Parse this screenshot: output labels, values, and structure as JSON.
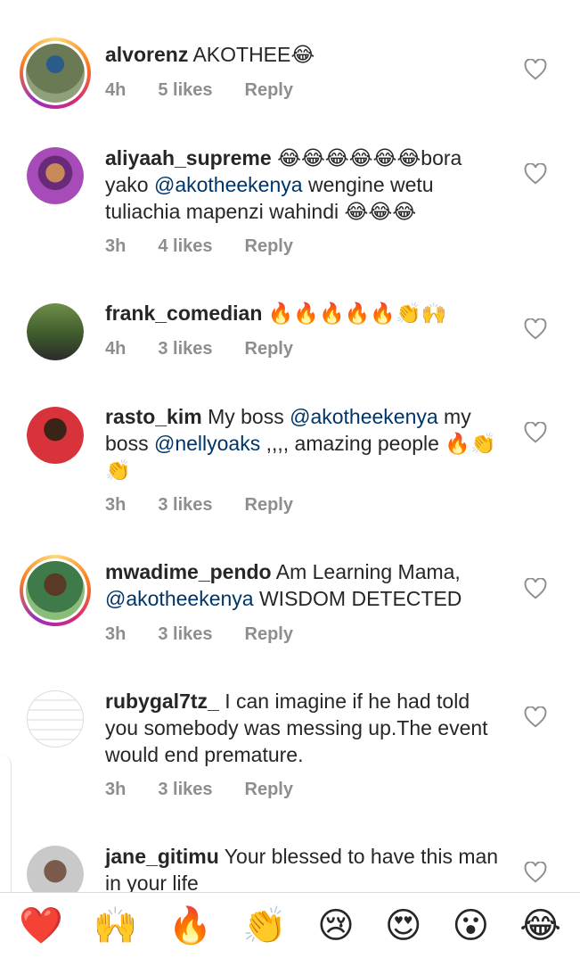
{
  "comments": [
    {
      "username": "alvorenz",
      "text": "AKOTHEE😂",
      "time": "4h",
      "likes": "5 likes",
      "reply": "Reply",
      "mention": "",
      "text2": "",
      "text3": ""
    },
    {
      "username": "aliyaah_supreme",
      "text": "😂😂😂😂😂😂bora yako ",
      "mention": "@akotheekenya",
      "text2": " wengine wetu tuliachia mapenzi wahindi 😂😂😂",
      "time": "3h",
      "likes": "4 likes",
      "reply": "Reply",
      "text3": ""
    },
    {
      "username": "frank_comedian",
      "text": "🔥🔥🔥🔥🔥👏🙌",
      "time": "4h",
      "likes": "3 likes",
      "reply": "Reply",
      "mention": "",
      "text2": "",
      "text3": ""
    },
    {
      "username": "rasto_kim",
      "text": "My boss ",
      "mention": "@akotheekenya",
      "text2": "  my boss ",
      "mention2": "@nellyoaks",
      "text3": " ,,,, amazing people 🔥👏👏",
      "time": "3h",
      "likes": "3 likes",
      "reply": "Reply"
    },
    {
      "username": "mwadime_pendo",
      "text": "Am Learning Mama, ",
      "mention": "@akotheekenya",
      "text2": " WISDOM DETECTED",
      "time": "3h",
      "likes": "3 likes",
      "reply": "Reply",
      "text3": ""
    },
    {
      "username": "rubygal7tz_",
      "text": "I can imagine if he had told you somebody was messing up.The event would end premature.",
      "time": "3h",
      "likes": "3 likes",
      "reply": "Reply",
      "mention": "",
      "text2": "",
      "text3": ""
    },
    {
      "username": "jane_gitimu",
      "text": "Your blessed to have this man in your life",
      "time": "",
      "likes": "",
      "reply": "",
      "mention": "",
      "text2": "",
      "text3": ""
    }
  ],
  "emoji_bar": [
    "❤️",
    "🙌",
    "🔥",
    "👏",
    "😢",
    "😍",
    "😮",
    "😂"
  ]
}
